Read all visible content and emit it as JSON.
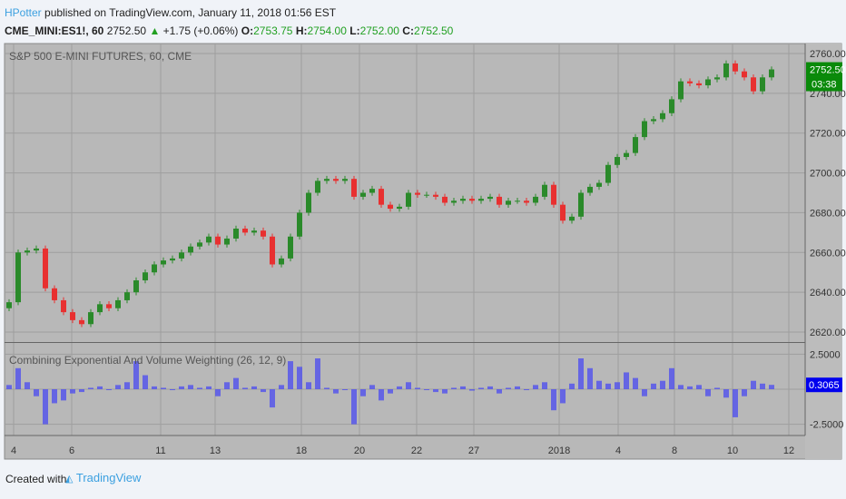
{
  "header": {
    "author": "HPotter",
    "published": "published on TradingView.com, January 11, 2018 01:56 EST",
    "symbol": "CME_MINI:ES1!, 60",
    "last": "2752.50",
    "arrow": "▲",
    "change": "+1.75 (+0.06%)",
    "o_label": "O:",
    "o": "2753.75",
    "h_label": "H:",
    "h": "2754.00",
    "l_label": "L:",
    "l": "2752.00",
    "c_label": "C:",
    "c": "2752.50"
  },
  "footer": {
    "created": "Created with",
    "brand": "TradingView"
  },
  "colors": {
    "up": "#2a8a2a",
    "down": "#e83030",
    "hist": "#5050ee",
    "bg": "#b8b8b8",
    "grid": "#9e9e9e"
  },
  "chart_data": [
    {
      "type": "candlestick",
      "title": "S&P 500 E-MINI FUTURES, 60, CME",
      "ylim": [
        2615,
        2765
      ],
      "yticks": [
        2620,
        2640,
        2660,
        2680,
        2700,
        2720,
        2740,
        2760
      ],
      "ytick_labels": [
        "2620.00",
        "2640.00",
        "2660.00",
        "2680.00",
        "2700.00",
        "2720.00",
        "2740.00",
        "2760.00"
      ],
      "last_price_label": "2752.50",
      "countdown_label": "03:38",
      "xticks": [
        {
          "label": "4",
          "bar": 0.5
        },
        {
          "label": "6",
          "bar": 6.9
        },
        {
          "label": "11",
          "bar": 16.7
        },
        {
          "label": "13",
          "bar": 22.7
        },
        {
          "label": "18",
          "bar": 32.2
        },
        {
          "label": "20",
          "bar": 38.6
        },
        {
          "label": "22",
          "bar": 44.9
        },
        {
          "label": "27",
          "bar": 51.2
        },
        {
          "label": "2018",
          "bar": 60.6
        },
        {
          "label": "4",
          "bar": 67.1
        },
        {
          "label": "8",
          "bar": 73.3
        },
        {
          "label": "10",
          "bar": 79.7
        },
        {
          "label": "12",
          "bar": 85.9
        }
      ],
      "closes": [
        2635,
        2660,
        2661,
        2662,
        2642,
        2636,
        2630,
        2626,
        2624,
        2630,
        2634,
        2632,
        2636,
        2640,
        2646,
        2650,
        2654,
        2656,
        2657,
        2660,
        2663,
        2665,
        2668,
        2664,
        2667,
        2672,
        2670,
        2671,
        2668,
        2654,
        2657,
        2668,
        2680,
        2690,
        2696,
        2697,
        2696,
        2697,
        2688,
        2690,
        2692,
        2684,
        2682,
        2683,
        2690,
        2689,
        2689,
        2688,
        2685,
        2686,
        2687,
        2686,
        2687,
        2688,
        2684,
        2686,
        2686,
        2685,
        2688,
        2694,
        2684,
        2676,
        2678,
        2690,
        2693,
        2695,
        2704,
        2708,
        2710,
        2718,
        2726,
        2727,
        2730,
        2737,
        2746,
        2745,
        2744,
        2747,
        2748,
        2755,
        2751,
        2748,
        2741,
        2748,
        2752
      ]
    },
    {
      "type": "bar",
      "title": "Combining Exponential And Volume Weighting (26, 12, 9)",
      "ylim": [
        -3.3,
        3.3
      ],
      "yticks": [
        -2.5,
        2.5
      ],
      "ytick_labels": [
        "-2.5000",
        "2.5000"
      ],
      "last_value_label": "0.3065",
      "values": [
        0.3,
        1.5,
        0.5,
        -0.5,
        -2.5,
        -1,
        -0.8,
        -0.3,
        -0.2,
        0.1,
        0.2,
        0,
        0.3,
        0.5,
        2,
        1,
        0.2,
        0.1,
        0,
        0.2,
        0.3,
        0.1,
        0.2,
        -0.5,
        0.5,
        0.8,
        0.1,
        0.2,
        -0.2,
        -1.3,
        0.3,
        2,
        1.6,
        0.5,
        2.2,
        0.1,
        -0.3,
        0,
        -2.5,
        -0.5,
        0.3,
        -0.8,
        -0.3,
        0.2,
        0.5,
        0.1,
        0,
        -0.2,
        -0.3,
        0.1,
        0.2,
        -0.1,
        0.1,
        0.2,
        -0.3,
        0.1,
        0.2,
        0,
        0.3,
        0.5,
        -1.5,
        -1,
        0.4,
        2.2,
        1.5,
        0.6,
        0.4,
        0.5,
        1.2,
        0.8,
        -0.5,
        0.4,
        0.6,
        1.5,
        0.3,
        0.2,
        0.3,
        -0.5,
        0.1,
        -0.6,
        -2,
        -0.5,
        0.6,
        0.4,
        0.31
      ]
    }
  ]
}
